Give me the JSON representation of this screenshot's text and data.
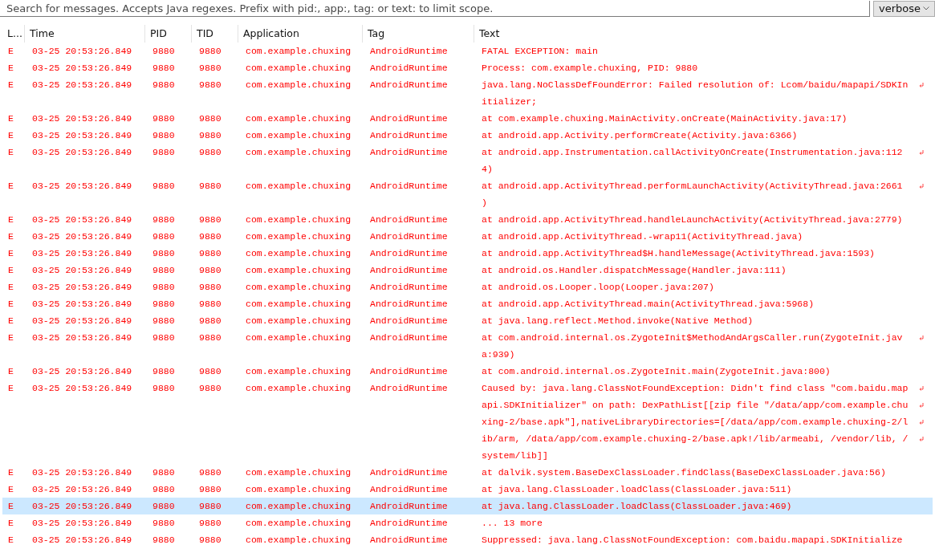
{
  "search": {
    "placeholder": "Search for messages. Accepts Java regexes. Prefix with pid:, app:, tag: or text: to limit scope."
  },
  "log_level": "verbose",
  "columns": [
    "L...",
    "Time",
    "PID",
    "TID",
    "Application",
    "Tag",
    "Text"
  ],
  "rows": [
    {
      "level": "E",
      "time": "03-25 20:53:26.849",
      "pid": "9880",
      "tid": "9880",
      "app": "com.example.chuxing",
      "tag": "AndroidRuntime",
      "selected": false,
      "lines": [
        "FATAL EXCEPTION: main"
      ]
    },
    {
      "level": "E",
      "time": "03-25 20:53:26.849",
      "pid": "9880",
      "tid": "9880",
      "app": "com.example.chuxing",
      "tag": "AndroidRuntime",
      "selected": false,
      "lines": [
        "Process: com.example.chuxing, PID: 9880"
      ]
    },
    {
      "level": "E",
      "time": "03-25 20:53:26.849",
      "pid": "9880",
      "tid": "9880",
      "app": "com.example.chuxing",
      "tag": "AndroidRuntime",
      "selected": false,
      "lines": [
        "java.lang.NoClassDefFoundError: Failed resolution of: Lcom/baidu/mapapi/SDKIn",
        "itializer;"
      ]
    },
    {
      "level": "E",
      "time": "03-25 20:53:26.849",
      "pid": "9880",
      "tid": "9880",
      "app": "com.example.chuxing",
      "tag": "AndroidRuntime",
      "selected": false,
      "lines": [
        "at com.example.chuxing.MainActivity.onCreate(MainActivity.java:17)"
      ]
    },
    {
      "level": "E",
      "time": "03-25 20:53:26.849",
      "pid": "9880",
      "tid": "9880",
      "app": "com.example.chuxing",
      "tag": "AndroidRuntime",
      "selected": false,
      "lines": [
        "at android.app.Activity.performCreate(Activity.java:6366)"
      ]
    },
    {
      "level": "E",
      "time": "03-25 20:53:26.849",
      "pid": "9880",
      "tid": "9880",
      "app": "com.example.chuxing",
      "tag": "AndroidRuntime",
      "selected": false,
      "lines": [
        "at android.app.Instrumentation.callActivityOnCreate(Instrumentation.java:112",
        "4)"
      ]
    },
    {
      "level": "E",
      "time": "03-25 20:53:26.849",
      "pid": "9880",
      "tid": "9880",
      "app": "com.example.chuxing",
      "tag": "AndroidRuntime",
      "selected": false,
      "lines": [
        "at android.app.ActivityThread.performLaunchActivity(ActivityThread.java:2661",
        ")"
      ]
    },
    {
      "level": "E",
      "time": "03-25 20:53:26.849",
      "pid": "9880",
      "tid": "9880",
      "app": "com.example.chuxing",
      "tag": "AndroidRuntime",
      "selected": false,
      "lines": [
        "at android.app.ActivityThread.handleLaunchActivity(ActivityThread.java:2779)"
      ]
    },
    {
      "level": "E",
      "time": "03-25 20:53:26.849",
      "pid": "9880",
      "tid": "9880",
      "app": "com.example.chuxing",
      "tag": "AndroidRuntime",
      "selected": false,
      "lines": [
        "at android.app.ActivityThread.-wrap11(ActivityThread.java)"
      ]
    },
    {
      "level": "E",
      "time": "03-25 20:53:26.849",
      "pid": "9880",
      "tid": "9880",
      "app": "com.example.chuxing",
      "tag": "AndroidRuntime",
      "selected": false,
      "lines": [
        "at android.app.ActivityThread$H.handleMessage(ActivityThread.java:1593)"
      ]
    },
    {
      "level": "E",
      "time": "03-25 20:53:26.849",
      "pid": "9880",
      "tid": "9880",
      "app": "com.example.chuxing",
      "tag": "AndroidRuntime",
      "selected": false,
      "lines": [
        "at android.os.Handler.dispatchMessage(Handler.java:111)"
      ]
    },
    {
      "level": "E",
      "time": "03-25 20:53:26.849",
      "pid": "9880",
      "tid": "9880",
      "app": "com.example.chuxing",
      "tag": "AndroidRuntime",
      "selected": false,
      "lines": [
        "at android.os.Looper.loop(Looper.java:207)"
      ]
    },
    {
      "level": "E",
      "time": "03-25 20:53:26.849",
      "pid": "9880",
      "tid": "9880",
      "app": "com.example.chuxing",
      "tag": "AndroidRuntime",
      "selected": false,
      "lines": [
        "at android.app.ActivityThread.main(ActivityThread.java:5968)"
      ]
    },
    {
      "level": "E",
      "time": "03-25 20:53:26.849",
      "pid": "9880",
      "tid": "9880",
      "app": "com.example.chuxing",
      "tag": "AndroidRuntime",
      "selected": false,
      "lines": [
        "at java.lang.reflect.Method.invoke(Native Method)"
      ]
    },
    {
      "level": "E",
      "time": "03-25 20:53:26.849",
      "pid": "9880",
      "tid": "9880",
      "app": "com.example.chuxing",
      "tag": "AndroidRuntime",
      "selected": false,
      "lines": [
        "at com.android.internal.os.ZygoteInit$MethodAndArgsCaller.run(ZygoteInit.jav",
        "a:939)"
      ]
    },
    {
      "level": "E",
      "time": "03-25 20:53:26.849",
      "pid": "9880",
      "tid": "9880",
      "app": "com.example.chuxing",
      "tag": "AndroidRuntime",
      "selected": false,
      "lines": [
        "at com.android.internal.os.ZygoteInit.main(ZygoteInit.java:800)"
      ]
    },
    {
      "level": "E",
      "time": "03-25 20:53:26.849",
      "pid": "9880",
      "tid": "9880",
      "app": "com.example.chuxing",
      "tag": "AndroidRuntime",
      "selected": false,
      "lines": [
        "Caused by: java.lang.ClassNotFoundException: Didn't find class \"com.baidu.map",
        "api.SDKInitializer\" on path: DexPathList[[zip file \"/data/app/com.example.chu",
        "xing-2/base.apk\"],nativeLibraryDirectories=[/data/app/com.example.chuxing-2/l",
        "ib/arm, /data/app/com.example.chuxing-2/base.apk!/lib/armeabi, /vendor/lib, /",
        "system/lib]]"
      ]
    },
    {
      "level": "E",
      "time": "03-25 20:53:26.849",
      "pid": "9880",
      "tid": "9880",
      "app": "com.example.chuxing",
      "tag": "AndroidRuntime",
      "selected": false,
      "lines": [
        "at dalvik.system.BaseDexClassLoader.findClass(BaseDexClassLoader.java:56)"
      ]
    },
    {
      "level": "E",
      "time": "03-25 20:53:26.849",
      "pid": "9880",
      "tid": "9880",
      "app": "com.example.chuxing",
      "tag": "AndroidRuntime",
      "selected": false,
      "lines": [
        "at java.lang.ClassLoader.loadClass(ClassLoader.java:511)"
      ]
    },
    {
      "level": "E",
      "time": "03-25 20:53:26.849",
      "pid": "9880",
      "tid": "9880",
      "app": "com.example.chuxing",
      "tag": "AndroidRuntime",
      "selected": true,
      "lines": [
        "at java.lang.ClassLoader.loadClass(ClassLoader.java:469)"
      ]
    },
    {
      "level": "E",
      "time": "03-25 20:53:26.849",
      "pid": "9880",
      "tid": "9880",
      "app": "com.example.chuxing",
      "tag": "AndroidRuntime",
      "selected": false,
      "lines": [
        "... 13 more"
      ]
    },
    {
      "level": "E",
      "time": "03-25 20:53:26.849",
      "pid": "9880",
      "tid": "9880",
      "app": "com.example.chuxing",
      "tag": "AndroidRuntime",
      "selected": false,
      "lines": [
        "Suppressed: java.lang.ClassNotFoundException: com.baidu.mapapi.SDKInitialize"
      ]
    }
  ]
}
